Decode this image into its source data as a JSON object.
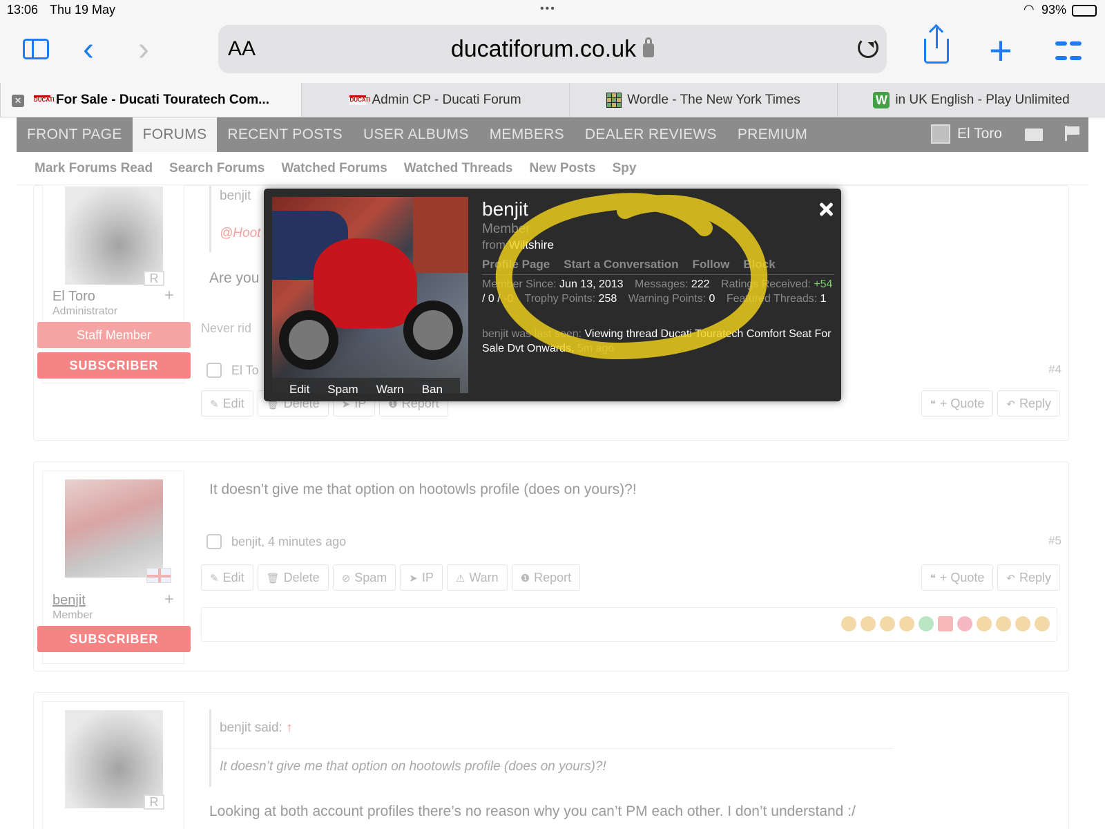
{
  "status_bar": {
    "time": "13:06",
    "date": "Thu 19 May",
    "battery_pct": "93%",
    "battery_level": 0.93
  },
  "browser": {
    "text_size_label": "AA",
    "url": "ducatiforum.co.uk",
    "tabs": [
      {
        "title": "For Sale - Ducati Touratech Com...",
        "active": true,
        "icon": "ducati-forum-favicon"
      },
      {
        "title": "Admin CP - Ducati Forum",
        "active": false,
        "icon": "ducati-forum-favicon"
      },
      {
        "title": "Wordle - The New York Times",
        "active": false,
        "icon": "wordle-favicon"
      },
      {
        "title": "in UK English - Play Unlimited",
        "active": false,
        "icon": "w-favicon"
      }
    ],
    "colors": {
      "accent": "#1d7cf2"
    }
  },
  "nav": {
    "items": [
      "FRONT PAGE",
      "FORUMS",
      "RECENT POSTS",
      "USER ALBUMS",
      "MEMBERS",
      "DEALER REVIEWS",
      "PREMIUM"
    ],
    "active": "FORUMS",
    "user": "El Toro",
    "sub_items": [
      "Mark Forums Read",
      "Search Forums",
      "Watched Forums",
      "Watched Threads",
      "New Posts",
      "Spy"
    ]
  },
  "posts": [
    {
      "author": "El Toro",
      "role": "Administrator",
      "badges": [
        "Staff Member",
        "SUBSCRIBER"
      ],
      "quote_author": "benjit",
      "quote_snippet": "@Hoot",
      "text": "Are you",
      "text2": "Never rid",
      "meta_author": "El To",
      "number": "#4",
      "actions": [
        "Edit",
        "Delete",
        "IP",
        "Report"
      ],
      "right_actions": [
        "+ Quote",
        "Reply"
      ]
    },
    {
      "author": "benjit",
      "role": "Member",
      "badges": [
        "SUBSCRIBER"
      ],
      "text": "It doesn’t give me that option on hootowls profile (does on yours)?!",
      "meta": "benjit, 4 minutes ago",
      "number": "#5",
      "actions": [
        "Edit",
        "Delete",
        "Spam",
        "IP",
        "Warn",
        "Report"
      ],
      "right_actions": [
        "+ Quote",
        "Reply"
      ]
    },
    {
      "quote_header": "benjit said:",
      "quote_text": "It doesn’t give me that option on hootowls profile (does on yours)?!",
      "text": "Looking at both account profiles there’s no reason why you can’t PM each other. I don’t understand :/"
    }
  ],
  "popup": {
    "name": "benjit",
    "role": "Member",
    "from_label": "from",
    "location": "Wiltshire",
    "links": [
      "Profile Page",
      "Start a Conversation",
      "Follow",
      "Block"
    ],
    "photo_actions": [
      "Edit",
      "Spam",
      "Warn",
      "Ban"
    ],
    "stats": {
      "member_since_label": "Member Since:",
      "member_since": "Jun 13, 2013",
      "messages_label": "Messages:",
      "messages": "222",
      "ratings_label": "Ratings Received:",
      "ratings_pos": "+54",
      "ratings_neutral": "/ 0 /",
      "ratings_neg": "-0",
      "trophy_label": "Trophy Points:",
      "trophy": "258",
      "warning_label": "Warning Points:",
      "warning": "0",
      "featured_label": "Featured Threads:",
      "featured": "1"
    },
    "last_seen_label": "benjit was last seen:",
    "last_seen": "Viewing thread Ducati Touratech Comfort Seat For Sale Dvt Onwards,",
    "last_seen_ago": "5m ago",
    "colors": {
      "background": "#2b2b2b",
      "positive": "#7bd36a",
      "negative": "#e07b64"
    }
  },
  "annotation": {
    "color": "#f2d21b"
  }
}
